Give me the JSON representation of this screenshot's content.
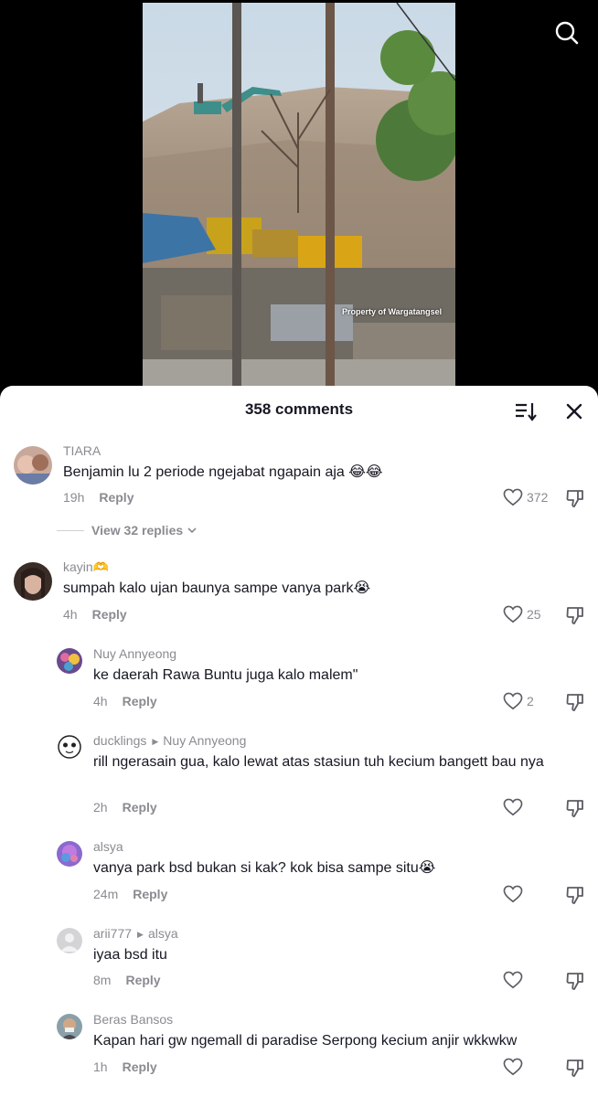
{
  "video": {
    "watermark": "Property of Wargatangsel"
  },
  "header": {
    "comments_count": "358 comments"
  },
  "comments": [
    {
      "username": "TIARA",
      "text": "Benjamin lu 2 periode ngejabat ngapain aja 😂😂",
      "time": "19h",
      "reply_label": "Reply",
      "likes": "372"
    },
    {
      "username": "kayin🫶",
      "text": "sumpah kalo ujan baunya sampe vanya park😭",
      "time": "4h",
      "reply_label": "Reply",
      "likes": "25"
    },
    {
      "username": "Nuy Annyeong",
      "text": "ke daerah Rawa Buntu juga kalo malem\"",
      "time": "4h",
      "reply_label": "Reply",
      "likes": "2"
    },
    {
      "username": "ducklings",
      "reply_to": "Nuy Annyeong",
      "text": "rill ngerasain gua, kalo lewat atas stasiun tuh kecium bangett bau nya",
      "time": "2h",
      "reply_label": "Reply",
      "likes": ""
    },
    {
      "username": "alsya",
      "text": "vanya park bsd bukan si kak? kok bisa sampe situ😭",
      "time": "24m",
      "reply_label": "Reply",
      "likes": ""
    },
    {
      "username": "arii777",
      "reply_to": "alsya",
      "text": "iyaa bsd itu",
      "time": "8m",
      "reply_label": "Reply",
      "likes": ""
    },
    {
      "username": "Beras Bansos",
      "text": "Kapan hari gw ngemall di paradise Serpong kecium anjir wkkwkw",
      "time": "1h",
      "reply_label": "Reply",
      "likes": ""
    }
  ],
  "view_replies": "View 32 replies",
  "colors": {
    "text_primary": "#161823",
    "text_secondary": "#8a8b91",
    "background": "#ffffff"
  },
  "icons": {
    "search": "search-icon",
    "sort": "sort-icon",
    "close": "close-icon",
    "like": "heart-icon",
    "dislike": "dislike-icon",
    "chevron": "chevron-down-icon"
  }
}
